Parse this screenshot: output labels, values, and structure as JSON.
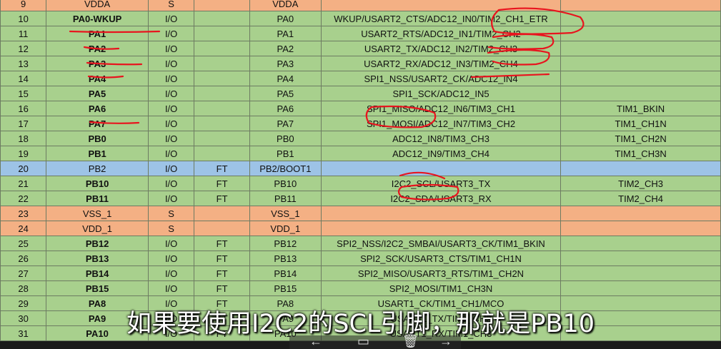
{
  "rows": [
    {
      "num": "9",
      "name": "VDDA",
      "name_bold": false,
      "type": "S",
      "level": "",
      "main": "VDDA",
      "default": "",
      "remap": "",
      "color": "o"
    },
    {
      "num": "10",
      "name": "PA0-WKUP",
      "name_bold": true,
      "type": "I/O",
      "level": "",
      "main": "PA0",
      "default": "WKUP/USART2_CTS/ADC12_IN0/TIM2_CH1_ETR",
      "remap": "",
      "color": "g"
    },
    {
      "num": "11",
      "name": "PA1",
      "name_bold": true,
      "type": "I/O",
      "level": "",
      "main": "PA1",
      "default": "USART2_RTS/ADC12_IN1/TIM2_CH2",
      "remap": "",
      "color": "g"
    },
    {
      "num": "12",
      "name": "PA2",
      "name_bold": true,
      "type": "I/O",
      "level": "",
      "main": "PA2",
      "default": "USART2_TX/ADC12_IN2/TIM2_CH3",
      "remap": "",
      "color": "g"
    },
    {
      "num": "13",
      "name": "PA3",
      "name_bold": true,
      "type": "I/O",
      "level": "",
      "main": "PA3",
      "default": "USART2_RX/ADC12_IN3/TIM2_CH4",
      "remap": "",
      "color": "g"
    },
    {
      "num": "14",
      "name": "PA4",
      "name_bold": true,
      "type": "I/O",
      "level": "",
      "main": "PA4",
      "default": "SPI1_NSS/USART2_CK/ADC12_IN4",
      "remap": "",
      "color": "g"
    },
    {
      "num": "15",
      "name": "PA5",
      "name_bold": true,
      "type": "I/O",
      "level": "",
      "main": "PA5",
      "default": "SPI1_SCK/ADC12_IN5",
      "remap": "",
      "color": "g"
    },
    {
      "num": "16",
      "name": "PA6",
      "name_bold": true,
      "type": "I/O",
      "level": "",
      "main": "PA6",
      "default": "SPI1_MISO/ADC12_IN6/TIM3_CH1",
      "remap": "TIM1_BKIN",
      "color": "g"
    },
    {
      "num": "17",
      "name": "PA7",
      "name_bold": true,
      "type": "I/O",
      "level": "",
      "main": "PA7",
      "default": "SPI1_MOSI/ADC12_IN7/TIM3_CH2",
      "remap": "TIM1_CH1N",
      "color": "g"
    },
    {
      "num": "18",
      "name": "PB0",
      "name_bold": true,
      "type": "I/O",
      "level": "",
      "main": "PB0",
      "default": "ADC12_IN8/TIM3_CH3",
      "remap": "TIM1_CH2N",
      "color": "g"
    },
    {
      "num": "19",
      "name": "PB1",
      "name_bold": true,
      "type": "I/O",
      "level": "",
      "main": "PB1",
      "default": "ADC12_IN9/TIM3_CH4",
      "remap": "TIM1_CH3N",
      "color": "g"
    },
    {
      "num": "20",
      "name": "PB2",
      "name_bold": false,
      "type": "I/O",
      "level": "FT",
      "main": "PB2/BOOT1",
      "default": "",
      "remap": "",
      "color": "b"
    },
    {
      "num": "21",
      "name": "PB10",
      "name_bold": true,
      "type": "I/O",
      "level": "FT",
      "main": "PB10",
      "default": "I2C2_SCL/USART3_TX",
      "remap": "TIM2_CH3",
      "color": "g"
    },
    {
      "num": "22",
      "name": "PB11",
      "name_bold": true,
      "type": "I/O",
      "level": "FT",
      "main": "PB11",
      "default": "I2C2_SDA/USART3_RX",
      "remap": "TIM2_CH4",
      "color": "g"
    },
    {
      "num": "23",
      "name": "VSS_1",
      "name_bold": false,
      "type": "S",
      "level": "",
      "main": "VSS_1",
      "default": "",
      "remap": "",
      "color": "o"
    },
    {
      "num": "24",
      "name": "VDD_1",
      "name_bold": false,
      "type": "S",
      "level": "",
      "main": "VDD_1",
      "default": "",
      "remap": "",
      "color": "o"
    },
    {
      "num": "25",
      "name": "PB12",
      "name_bold": true,
      "type": "I/O",
      "level": "FT",
      "main": "PB12",
      "default": "SPI2_NSS/I2C2_SMBAI/USART3_CK/TIM1_BKIN",
      "remap": "",
      "color": "g"
    },
    {
      "num": "26",
      "name": "PB13",
      "name_bold": true,
      "type": "I/O",
      "level": "FT",
      "main": "PB13",
      "default": "SPI2_SCK/USART3_CTS/TIM1_CH1N",
      "remap": "",
      "color": "g"
    },
    {
      "num": "27",
      "name": "PB14",
      "name_bold": true,
      "type": "I/O",
      "level": "FT",
      "main": "PB14",
      "default": "SPI2_MISO/USART3_RTS/TIM1_CH2N",
      "remap": "",
      "color": "g"
    },
    {
      "num": "28",
      "name": "PB15",
      "name_bold": true,
      "type": "I/O",
      "level": "FT",
      "main": "PB15",
      "default": "SPI2_MOSI/TIM1_CH3N",
      "remap": "",
      "color": "g"
    },
    {
      "num": "29",
      "name": "PA8",
      "name_bold": true,
      "type": "I/O",
      "level": "FT",
      "main": "PA8",
      "default": "USART1_CK/TIM1_CH1/MCO",
      "remap": "",
      "color": "g"
    },
    {
      "num": "30",
      "name": "PA9",
      "name_bold": true,
      "type": "I/O",
      "level": "FT",
      "main": "PA9",
      "default": "USART1_TX/TIM1_CH2",
      "remap": "",
      "color": "g"
    },
    {
      "num": "31",
      "name": "PA10",
      "name_bold": true,
      "type": "I/O",
      "level": "FT",
      "main": "PA10",
      "default": "USART1_RX/TIM1_CH3",
      "remap": "",
      "color": "g"
    }
  ],
  "subtitle": "如果要使用I2C2的SCL引脚，那就是PB10",
  "overlay": {
    "back_icon": "←",
    "save_icon": "▭",
    "delete_icon": "🗑",
    "forward_icon": "→"
  },
  "colors": {
    "green": "#a8d08d",
    "orange": "#f4b084",
    "blue": "#9dc3e6",
    "annotation": "#e8141e"
  }
}
